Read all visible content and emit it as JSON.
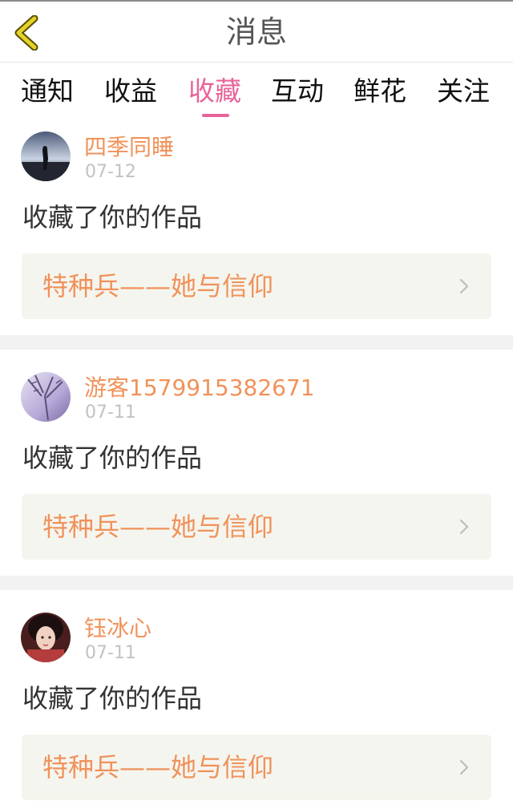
{
  "header": {
    "title": "消息",
    "back_icon": "chevron-left-icon",
    "accent_color": "#d4c21f"
  },
  "tabs": [
    {
      "label": "通知",
      "active": false
    },
    {
      "label": "收益",
      "active": false
    },
    {
      "label": "收藏",
      "active": true
    },
    {
      "label": "互动",
      "active": false
    },
    {
      "label": "鲜花",
      "active": false
    },
    {
      "label": "关注",
      "active": false
    }
  ],
  "colors": {
    "active_tab": "#e8649a",
    "username": "#f0925a",
    "work_title": "#f0925a",
    "date": "#c2c2c2",
    "card_link_bg": "#f5f5ef"
  },
  "messages": [
    {
      "username": "四季同睡",
      "date": "07-12",
      "action": "收藏了你的作品",
      "work_title": "特种兵——她与信仰"
    },
    {
      "username": "游客1579915382671",
      "date": "07-11",
      "action": "收藏了你的作品",
      "work_title": "特种兵——她与信仰"
    },
    {
      "username": "钰冰心",
      "date": "07-11",
      "action": "收藏了你的作品",
      "work_title": "特种兵——她与信仰"
    }
  ]
}
